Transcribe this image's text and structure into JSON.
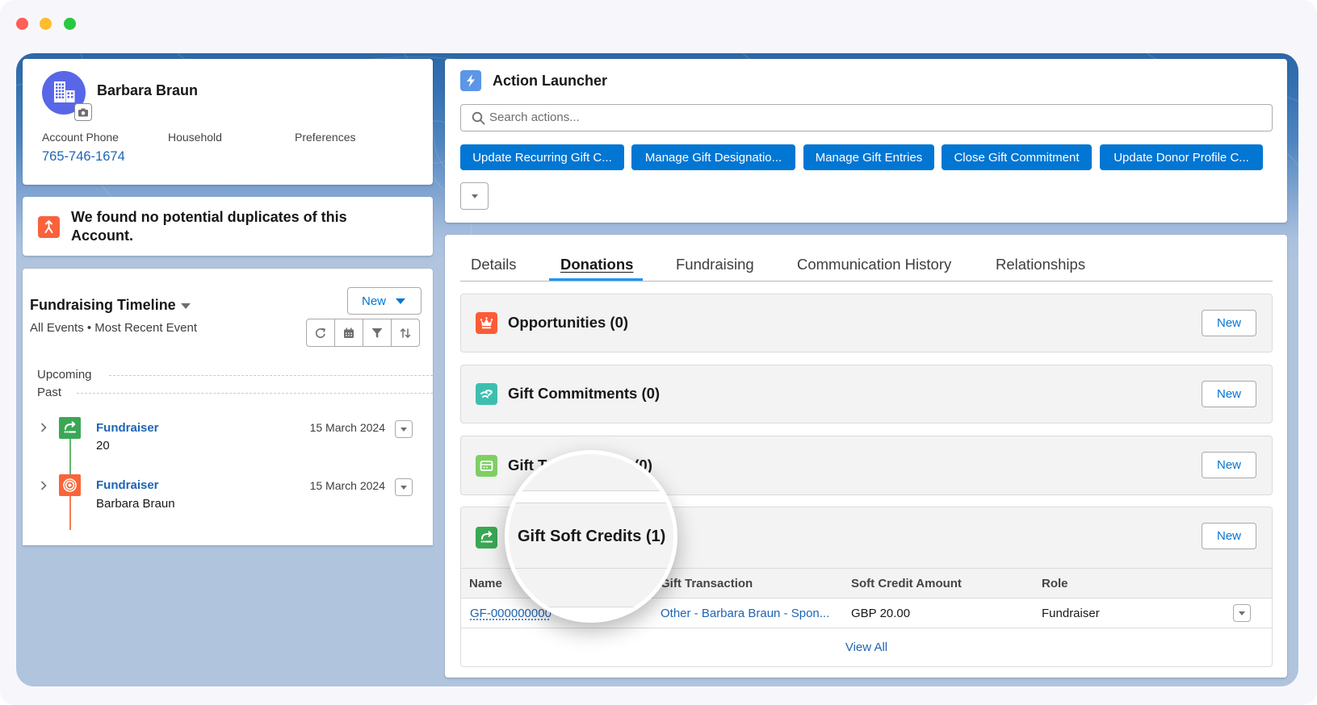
{
  "window_controls": {
    "close_color": "#fe5f57",
    "minimize_color": "#febc2e",
    "maximize_color": "#28c840"
  },
  "colors": {
    "brand_button": "#0176d3",
    "link": "#1d65b5",
    "active_tab_indicator": "#1b96ff",
    "avatar": "#5867e8",
    "duplicate_icon": "#f9623a",
    "action_icon": "#5c96e6"
  },
  "profile": {
    "name": "Barbara Braun",
    "fields": [
      {
        "label": "Account Phone",
        "value": "765-746-1674"
      },
      {
        "label": "Household",
        "value": ""
      },
      {
        "label": "Preferences",
        "value": ""
      }
    ]
  },
  "duplicates": {
    "message": "We found no potential duplicates of this Account."
  },
  "timeline": {
    "title": "Fundraising Timeline",
    "subtitle": "All Events • Most Recent Event",
    "new_label": "New",
    "toolbar": [
      "refresh-icon",
      "calendar-icon",
      "filter-icon",
      "sort-icon"
    ],
    "sections": {
      "upcoming": "Upcoming",
      "past": "Past"
    },
    "items": [
      {
        "title": "Fundraiser",
        "detail": "20",
        "date": "15 March 2024",
        "icon": "soft-credit-icon",
        "color": "#3ba755",
        "line_color": "#62b96c"
      },
      {
        "title": "Fundraiser",
        "detail": "Barbara Braun",
        "date": "15 March 2024",
        "icon": "target-icon",
        "color": "#f9653a",
        "line_color": "#f77b52"
      }
    ]
  },
  "action_launcher": {
    "title": "Action Launcher",
    "search_placeholder": "Search actions...",
    "actions": [
      "Update Recurring Gift C...",
      "Manage Gift Designatio...",
      "Manage Gift Entries",
      "Close Gift Commitment",
      "Update Donor Profile C..."
    ]
  },
  "tabs": [
    {
      "label": "Details",
      "active": false
    },
    {
      "label": "Donations",
      "active": true
    },
    {
      "label": "Fundraising",
      "active": false
    },
    {
      "label": "Communication History",
      "active": false
    },
    {
      "label": "Relationships",
      "active": false
    }
  ],
  "related_lists": [
    {
      "title": "Opportunities (0)",
      "new_label": "New",
      "icon": "crown-icon",
      "icon_color": "#fd5b36"
    },
    {
      "title": "Gift Commitments (0)",
      "new_label": "New",
      "icon": "handshake-icon",
      "icon_color": "#3dbfb0"
    },
    {
      "title": "Gift Transactions (0)",
      "new_label": "New",
      "icon": "card-icon",
      "icon_color": "#7dcf64"
    },
    {
      "title": "Gift Soft Credits (1)",
      "new_label": "New",
      "icon": "soft-credit-icon",
      "icon_color": "#3ba755"
    }
  ],
  "soft_credits": {
    "columns": [
      "Name",
      "Gift Transaction",
      "Soft Credit Amount",
      "Role"
    ],
    "rows": [
      {
        "name": "GF-000000000",
        "gift_transaction": "Other - Barbara Braun - Spon...",
        "amount": "GBP 20.00",
        "role": "Fundraiser"
      }
    ],
    "view_all": "View All"
  },
  "magnifier": {
    "text": "Gift Soft Credits (1)"
  }
}
